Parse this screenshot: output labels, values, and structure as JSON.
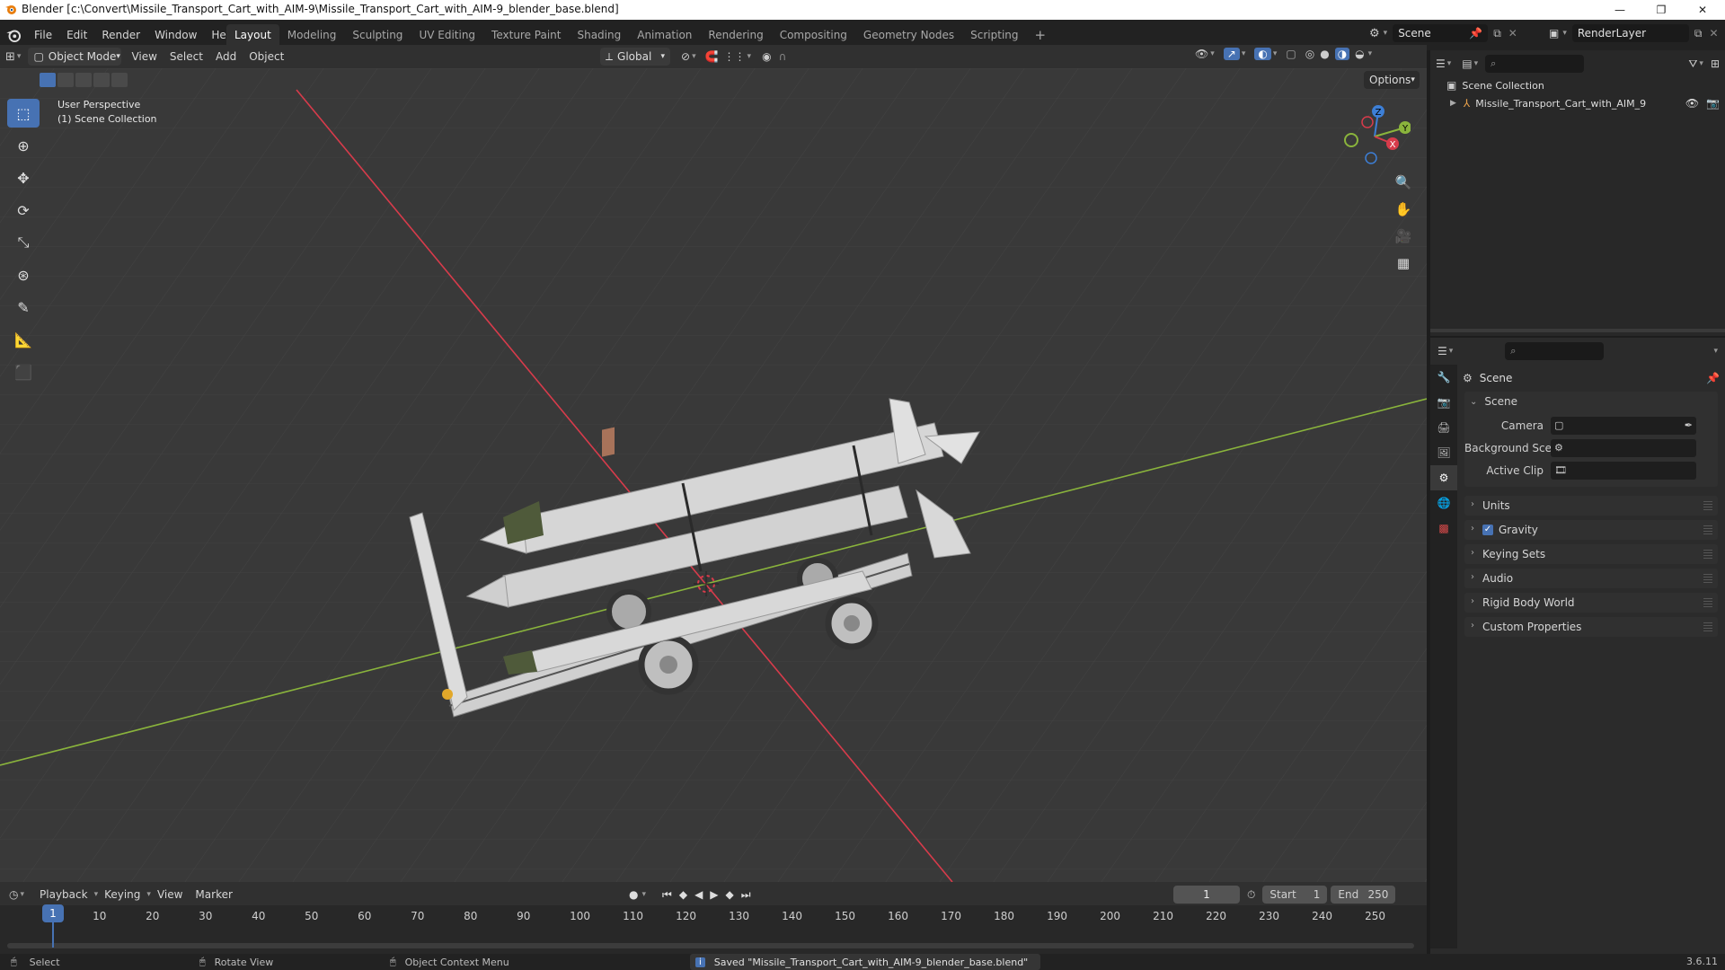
{
  "titlebar": {
    "title": "Blender [c:\\Convert\\Missile_Transport_Cart_with_AIM-9\\Missile_Transport_Cart_with_AIM-9_blender_base.blend]",
    "minimize": "—",
    "maximize": "❐",
    "close": "✕"
  },
  "menu": [
    "File",
    "Edit",
    "Render",
    "Window",
    "Help"
  ],
  "workspaces": [
    "Layout",
    "Modeling",
    "Sculpting",
    "UV Editing",
    "Texture Paint",
    "Shading",
    "Animation",
    "Rendering",
    "Compositing",
    "Geometry Nodes",
    "Scripting"
  ],
  "active_workspace": "Layout",
  "add_workspace": "+",
  "scene_selector": "Scene",
  "render_layer": "RenderLayer",
  "viewport_header": {
    "mode": "Object Mode",
    "menus": [
      "View",
      "Select",
      "Add",
      "Object"
    ],
    "transform_orientation": "Global",
    "options": "Options"
  },
  "viewport": {
    "perspective": "User Perspective",
    "collection": "(1) Scene Collection",
    "gizmo_axes": {
      "x": "X",
      "y": "Y",
      "z": "Z"
    }
  },
  "outliner": {
    "root": "Scene Collection",
    "items": [
      {
        "label": "Missile_Transport_Cart_with_AIM_9"
      }
    ]
  },
  "properties": {
    "context": "Scene",
    "section": "Scene",
    "fields": [
      {
        "label": "Camera",
        "value": ""
      },
      {
        "label": "Background Scene",
        "value": ""
      },
      {
        "label": "Active Clip",
        "value": ""
      }
    ],
    "panels": [
      "Units",
      "Gravity",
      "Keying Sets",
      "Audio",
      "Rigid Body World",
      "Custom Properties"
    ],
    "gravity_checked": true
  },
  "timeline": {
    "menus": [
      "Playback",
      "Keying",
      "View",
      "Marker"
    ],
    "current_frame": "1",
    "start_label": "Start",
    "start": "1",
    "end_label": "End",
    "end": "250",
    "ruler": [
      "1",
      "10",
      "20",
      "30",
      "40",
      "50",
      "60",
      "70",
      "80",
      "90",
      "100",
      "110",
      "120",
      "130",
      "140",
      "150",
      "160",
      "170",
      "180",
      "190",
      "200",
      "210",
      "220",
      "230",
      "240",
      "250"
    ]
  },
  "statusbar": {
    "select": "Select",
    "rotate": "Rotate View",
    "context_menu": "Object Context Menu",
    "message": "Saved \"Missile_Transport_Cart_with_AIM-9_blender_base.blend\"",
    "version": "3.6.11"
  },
  "colors": {
    "accent": "#4772b3",
    "x_axis": "#d73b4b",
    "y_axis": "#8ab43c",
    "z_axis": "#3d7fd6",
    "playhead": "#4772b3"
  }
}
